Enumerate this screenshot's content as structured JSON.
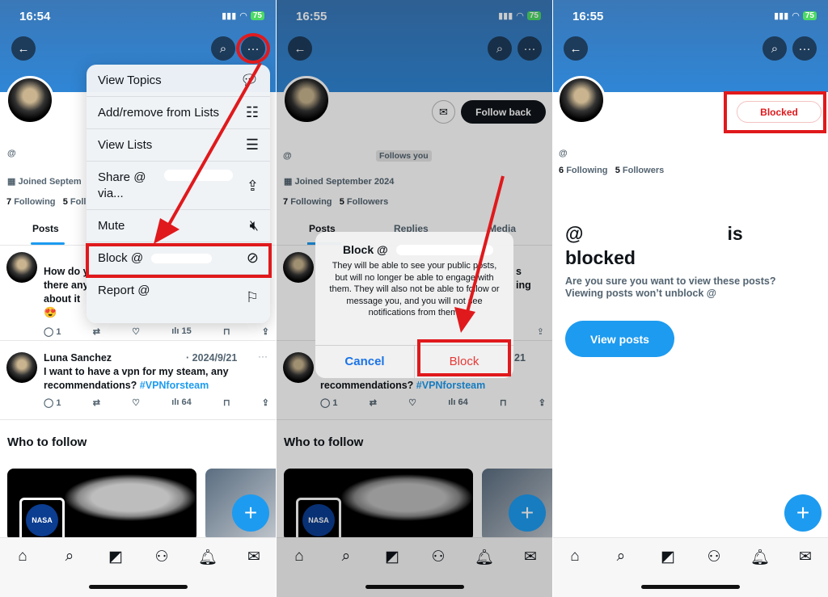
{
  "panels": [
    {
      "time": "16:54",
      "battery": "75",
      "profile": {
        "handle_prefix": "@",
        "joined": "Joined Septem",
        "following_count": "7",
        "following_label": "Following",
        "followers_count": "5",
        "followers_label": "Foll"
      },
      "tabs": [
        "Posts"
      ],
      "menu": [
        {
          "label": "View Topics",
          "icon": "topics-icon"
        },
        {
          "label": "Add/remove from Lists",
          "icon": "list-add-icon"
        },
        {
          "label": "View Lists",
          "icon": "list-icon"
        },
        {
          "label": "Share @\nvia...",
          "icon": "share-icon"
        },
        {
          "label": "Mute",
          "icon": "mute-icon"
        },
        {
          "label": "Block @",
          "icon": "block-icon"
        },
        {
          "label": "Report @",
          "icon": "flag-icon"
        }
      ],
      "posts": [
        {
          "text": "How do y\nthere any\nabout it",
          "emoji": "😍",
          "replies": "1",
          "views": "15"
        },
        {
          "author": "Luna Sanchez",
          "date": "· 2024/9/21",
          "text": "I want to have a vpn for my steam, any\nrecommendations? ",
          "hashtag": "#VPNforsteam",
          "replies": "1",
          "views": "64"
        }
      ],
      "who_to_follow": "Who to follow",
      "nasa_label": "NASA"
    },
    {
      "time": "16:55",
      "battery": "75",
      "follow_back": "Follow back",
      "follows_you": "Follows you",
      "profile": {
        "handle_prefix": "@",
        "joined": "Joined September 2024",
        "following_count": "7",
        "following_label": "Following",
        "followers_count": "5",
        "followers_label": "Followers"
      },
      "tabs": [
        "Posts",
        "Replies",
        "Media"
      ],
      "dialog": {
        "title": "Block @",
        "body": "They will be able to see your public posts, but will no longer be able to engage with them. They will also not be able to follow or message you, and you will not see notifications from them.",
        "cancel": "Cancel",
        "confirm": "Block"
      },
      "posts": [
        {
          "text_end": "s\ning"
        },
        {
          "date": "21",
          "text": "recommendations? ",
          "hashtag": "#VPNforsteam",
          "replies": "1",
          "views": "64"
        }
      ],
      "who_to_follow": "Who to follow",
      "nasa_label": "NASA"
    },
    {
      "time": "16:55",
      "battery": "75",
      "blocked_button": "Blocked",
      "profile": {
        "handle_prefix": "@",
        "following_count": "6",
        "following_label": "Following",
        "followers_count": "5",
        "followers_label": "Followers"
      },
      "blocked": {
        "title_prefix": "@",
        "title_suffix": "is",
        "title_line2": "blocked",
        "subtitle1": "Are you sure you want to view these posts?",
        "subtitle2": "Viewing posts won’t unblock @",
        "view_posts": "View posts"
      }
    }
  ],
  "colors": {
    "accent": "#1d9bf0",
    "annotation_red": "#e0191c",
    "header_blue": "#2f86d6"
  }
}
